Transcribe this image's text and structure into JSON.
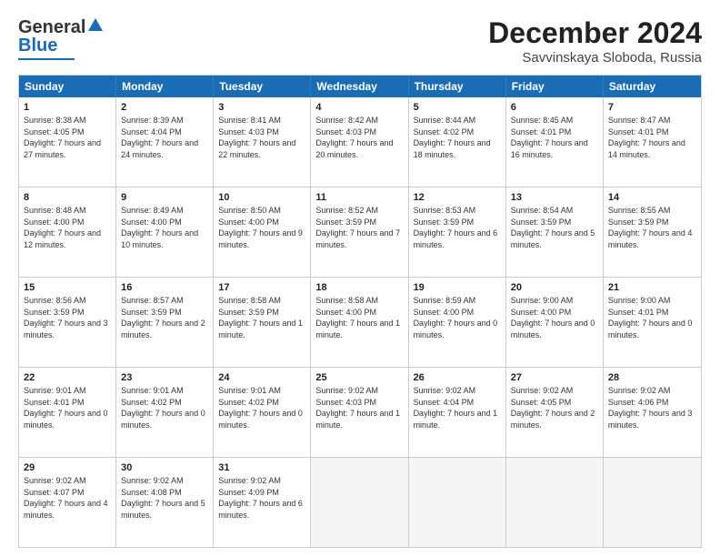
{
  "logo": {
    "line1": "General",
    "line2": "Blue"
  },
  "title": "December 2024",
  "subtitle": "Savvinskaya Sloboda, Russia",
  "header_days": [
    "Sunday",
    "Monday",
    "Tuesday",
    "Wednesday",
    "Thursday",
    "Friday",
    "Saturday"
  ],
  "weeks": [
    [
      {
        "day": "1",
        "sunrise": "Sunrise: 8:38 AM",
        "sunset": "Sunset: 4:05 PM",
        "daylight": "Daylight: 7 hours and 27 minutes."
      },
      {
        "day": "2",
        "sunrise": "Sunrise: 8:39 AM",
        "sunset": "Sunset: 4:04 PM",
        "daylight": "Daylight: 7 hours and 24 minutes."
      },
      {
        "day": "3",
        "sunrise": "Sunrise: 8:41 AM",
        "sunset": "Sunset: 4:03 PM",
        "daylight": "Daylight: 7 hours and 22 minutes."
      },
      {
        "day": "4",
        "sunrise": "Sunrise: 8:42 AM",
        "sunset": "Sunset: 4:03 PM",
        "daylight": "Daylight: 7 hours and 20 minutes."
      },
      {
        "day": "5",
        "sunrise": "Sunrise: 8:44 AM",
        "sunset": "Sunset: 4:02 PM",
        "daylight": "Daylight: 7 hours and 18 minutes."
      },
      {
        "day": "6",
        "sunrise": "Sunrise: 8:45 AM",
        "sunset": "Sunset: 4:01 PM",
        "daylight": "Daylight: 7 hours and 16 minutes."
      },
      {
        "day": "7",
        "sunrise": "Sunrise: 8:47 AM",
        "sunset": "Sunset: 4:01 PM",
        "daylight": "Daylight: 7 hours and 14 minutes."
      }
    ],
    [
      {
        "day": "8",
        "sunrise": "Sunrise: 8:48 AM",
        "sunset": "Sunset: 4:00 PM",
        "daylight": "Daylight: 7 hours and 12 minutes."
      },
      {
        "day": "9",
        "sunrise": "Sunrise: 8:49 AM",
        "sunset": "Sunset: 4:00 PM",
        "daylight": "Daylight: 7 hours and 10 minutes."
      },
      {
        "day": "10",
        "sunrise": "Sunrise: 8:50 AM",
        "sunset": "Sunset: 4:00 PM",
        "daylight": "Daylight: 7 hours and 9 minutes."
      },
      {
        "day": "11",
        "sunrise": "Sunrise: 8:52 AM",
        "sunset": "Sunset: 3:59 PM",
        "daylight": "Daylight: 7 hours and 7 minutes."
      },
      {
        "day": "12",
        "sunrise": "Sunrise: 8:53 AM",
        "sunset": "Sunset: 3:59 PM",
        "daylight": "Daylight: 7 hours and 6 minutes."
      },
      {
        "day": "13",
        "sunrise": "Sunrise: 8:54 AM",
        "sunset": "Sunset: 3:59 PM",
        "daylight": "Daylight: 7 hours and 5 minutes."
      },
      {
        "day": "14",
        "sunrise": "Sunrise: 8:55 AM",
        "sunset": "Sunset: 3:59 PM",
        "daylight": "Daylight: 7 hours and 4 minutes."
      }
    ],
    [
      {
        "day": "15",
        "sunrise": "Sunrise: 8:56 AM",
        "sunset": "Sunset: 3:59 PM",
        "daylight": "Daylight: 7 hours and 3 minutes."
      },
      {
        "day": "16",
        "sunrise": "Sunrise: 8:57 AM",
        "sunset": "Sunset: 3:59 PM",
        "daylight": "Daylight: 7 hours and 2 minutes."
      },
      {
        "day": "17",
        "sunrise": "Sunrise: 8:58 AM",
        "sunset": "Sunset: 3:59 PM",
        "daylight": "Daylight: 7 hours and 1 minute."
      },
      {
        "day": "18",
        "sunrise": "Sunrise: 8:58 AM",
        "sunset": "Sunset: 4:00 PM",
        "daylight": "Daylight: 7 hours and 1 minute."
      },
      {
        "day": "19",
        "sunrise": "Sunrise: 8:59 AM",
        "sunset": "Sunset: 4:00 PM",
        "daylight": "Daylight: 7 hours and 0 minutes."
      },
      {
        "day": "20",
        "sunrise": "Sunrise: 9:00 AM",
        "sunset": "Sunset: 4:00 PM",
        "daylight": "Daylight: 7 hours and 0 minutes."
      },
      {
        "day": "21",
        "sunrise": "Sunrise: 9:00 AM",
        "sunset": "Sunset: 4:01 PM",
        "daylight": "Daylight: 7 hours and 0 minutes."
      }
    ],
    [
      {
        "day": "22",
        "sunrise": "Sunrise: 9:01 AM",
        "sunset": "Sunset: 4:01 PM",
        "daylight": "Daylight: 7 hours and 0 minutes."
      },
      {
        "day": "23",
        "sunrise": "Sunrise: 9:01 AM",
        "sunset": "Sunset: 4:02 PM",
        "daylight": "Daylight: 7 hours and 0 minutes."
      },
      {
        "day": "24",
        "sunrise": "Sunrise: 9:01 AM",
        "sunset": "Sunset: 4:02 PM",
        "daylight": "Daylight: 7 hours and 0 minutes."
      },
      {
        "day": "25",
        "sunrise": "Sunrise: 9:02 AM",
        "sunset": "Sunset: 4:03 PM",
        "daylight": "Daylight: 7 hours and 1 minute."
      },
      {
        "day": "26",
        "sunrise": "Sunrise: 9:02 AM",
        "sunset": "Sunset: 4:04 PM",
        "daylight": "Daylight: 7 hours and 1 minute."
      },
      {
        "day": "27",
        "sunrise": "Sunrise: 9:02 AM",
        "sunset": "Sunset: 4:05 PM",
        "daylight": "Daylight: 7 hours and 2 minutes."
      },
      {
        "day": "28",
        "sunrise": "Sunrise: 9:02 AM",
        "sunset": "Sunset: 4:06 PM",
        "daylight": "Daylight: 7 hours and 3 minutes."
      }
    ],
    [
      {
        "day": "29",
        "sunrise": "Sunrise: 9:02 AM",
        "sunset": "Sunset: 4:07 PM",
        "daylight": "Daylight: 7 hours and 4 minutes."
      },
      {
        "day": "30",
        "sunrise": "Sunrise: 9:02 AM",
        "sunset": "Sunset: 4:08 PM",
        "daylight": "Daylight: 7 hours and 5 minutes."
      },
      {
        "day": "31",
        "sunrise": "Sunrise: 9:02 AM",
        "sunset": "Sunset: 4:09 PM",
        "daylight": "Daylight: 7 hours and 6 minutes."
      },
      {
        "day": "",
        "sunrise": "",
        "sunset": "",
        "daylight": ""
      },
      {
        "day": "",
        "sunrise": "",
        "sunset": "",
        "daylight": ""
      },
      {
        "day": "",
        "sunrise": "",
        "sunset": "",
        "daylight": ""
      },
      {
        "day": "",
        "sunrise": "",
        "sunset": "",
        "daylight": ""
      }
    ]
  ]
}
